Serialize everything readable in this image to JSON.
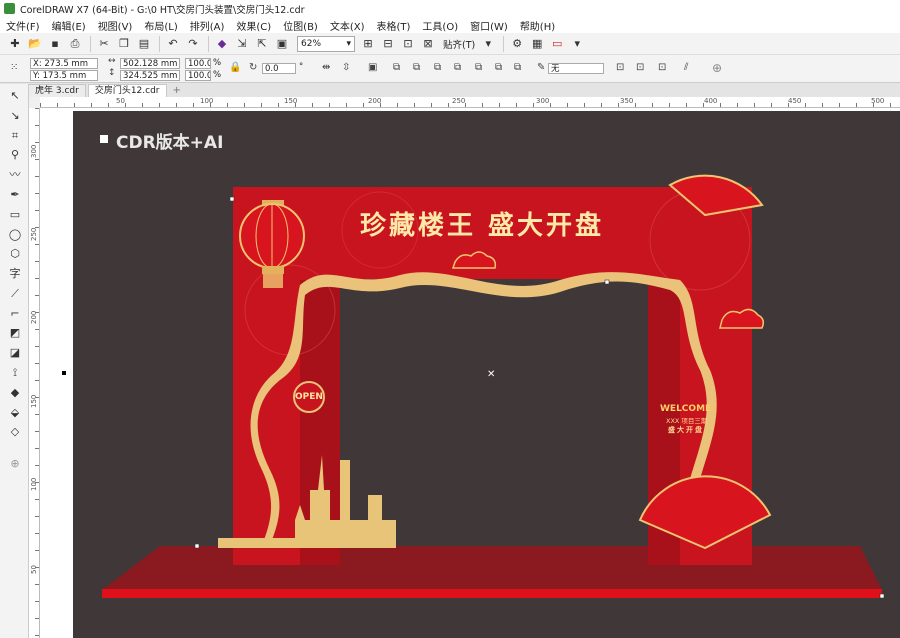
{
  "window": {
    "title": "CorelDRAW X7 (64-Bit) - G:\\0 HT\\交房门头装置\\交房门头12.cdr"
  },
  "menu": [
    "文件(F)",
    "编辑(E)",
    "视图(V)",
    "布局(L)",
    "排列(A)",
    "效果(C)",
    "位图(B)",
    "文本(X)",
    "表格(T)",
    "工具(O)",
    "窗口(W)",
    "帮助(H)"
  ],
  "toolbar": {
    "zoom": "62%",
    "snap_label": "贴齐(T)"
  },
  "properties": {
    "x": "X: 273.5 mm",
    "y": "Y: 173.5 mm",
    "width": "502.128 mm",
    "height": "324.525 mm",
    "scale_x": "100.0",
    "scale_y": "100.0",
    "scale_unit": "%",
    "rotation": "0.0",
    "rotation_unit": "°",
    "outline": "无"
  },
  "tabs": [
    "虎年 3.cdr",
    "交房门头12.cdr"
  ],
  "rulers": {
    "h": [
      "50",
      "100",
      "150",
      "200",
      "250",
      "300",
      "350",
      "400",
      "450",
      "500"
    ],
    "v": [
      "300",
      "250",
      "200",
      "150",
      "100",
      "50"
    ]
  },
  "canvas": {
    "watermark": "CDR版本+AI",
    "headline": "珍藏楼王  盛大开盘",
    "open_sign": "OPEN",
    "welcome": "WELCOME",
    "welcome_sub": "XXX 项目三期",
    "welcome_sub2": "盛大开盘"
  },
  "colors": {
    "accent_red": "#c8141e",
    "gold": "#e8c478",
    "canvas_bg": "#403838"
  }
}
